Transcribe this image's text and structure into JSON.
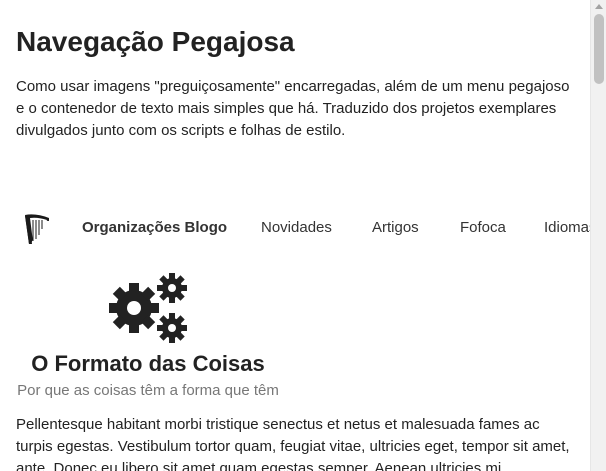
{
  "header": {
    "title": "Navegação Pegajosa",
    "description": "Como usar imagens \"preguiçosamente\" encarregadas, além de um menu pegajoso e o contenedor de texto mais simples que há. Traduzido dos projetos exemplares divulgados junto com os scripts e folhas de estilo."
  },
  "nav": {
    "logo_icon": "harp-icon",
    "brand": "Organizações Blogo",
    "items": [
      "Novidades",
      "Artigos",
      "Fofoca",
      "Idiomas"
    ]
  },
  "article": {
    "icon": "gears-icon",
    "title": "O Formato das Coisas",
    "subtitle": "Por que as coisas têm a forma que têm",
    "body": "Pellentesque habitant morbi tristique senectus et netus et malesuada fames ac turpis egestas. Vestibulum tortor quam, feugiat vitae, ultricies eget, tempor sit amet, ante. Donec eu libero sit amet quam egestas semper. Aenean ultricies mi"
  },
  "colors": {
    "text": "#222222",
    "muted": "#777777",
    "icon": "#222222"
  }
}
